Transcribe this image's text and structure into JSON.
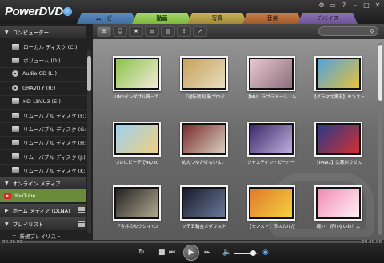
{
  "app": {
    "name": "PowerDVD"
  },
  "tabs": [
    {
      "label": "ムービー",
      "key": "movie"
    },
    {
      "label": "動画",
      "key": "video"
    },
    {
      "label": "写真",
      "key": "photo"
    },
    {
      "label": "音楽",
      "key": "music"
    },
    {
      "label": "デバイス",
      "key": "device"
    }
  ],
  "window_controls": [
    "gear-icon",
    "tv-icon",
    "help-icon",
    "minimize-icon",
    "maximize-icon",
    "close-icon"
  ],
  "sidebar": {
    "computer_label": "コンピューター",
    "drives": [
      {
        "label": "ローカル ディスク (C:)",
        "icon": "drive-icon"
      },
      {
        "label": "ボリューム (D:)",
        "icon": "drive-icon"
      },
      {
        "label": "Audio CD (L:)",
        "icon": "disc-icon"
      },
      {
        "label": "GRAVITY (R:)",
        "icon": "disc-icon"
      },
      {
        "label": "HD-LBVU3 (E:)",
        "icon": "drive-icon"
      },
      {
        "label": "リムーバブル ディスク (F:)",
        "icon": "drive-icon"
      },
      {
        "label": "リムーバブル ディスク (G:)",
        "icon": "drive-icon"
      },
      {
        "label": "リムーバブル ディスク (H:)",
        "icon": "drive-icon"
      },
      {
        "label": "リムーバブル ディスク (J:)",
        "icon": "drive-icon"
      },
      {
        "label": "リムーバブル ディスク (K:)",
        "icon": "drive-icon"
      }
    ],
    "online_label": "オンライン メディア",
    "youtube_label": "YouTube",
    "home_media_label": "ホーム メディア (DLNA)",
    "playlist_label": "プレイリスト",
    "new_playlist_label": "新規プレイリスト"
  },
  "toolbar": {
    "buttons": [
      "grid-view-icon",
      "people-icon",
      "star-icon",
      "list-view-icon",
      "slideshow-icon",
      "upload-icon",
      "share-icon"
    ],
    "search_placeholder": ""
  },
  "videos": [
    {
      "caption": "UNEペンダブル買って",
      "colors": [
        "#8bc34a",
        "#f2e9d8"
      ]
    },
    {
      "caption": "『逆転裁判 新プロジ",
      "colors": [
        "#c7a35a",
        "#e8dcc0"
      ]
    },
    {
      "caption": "【MV】ラブラドール・レ",
      "colors": [
        "#e9c7d1",
        "#8a6f7a"
      ]
    },
    {
      "caption": "【グラマス実況】モンスト",
      "colors": [
        "#4fa3e0",
        "#e6c23a"
      ]
    },
    {
      "caption": "ついにビーチで4K/30",
      "colors": [
        "#9dd0f0",
        "#f0d080"
      ]
    },
    {
      "caption": "めんつゆかけないよ。",
      "colors": [
        "#7a2a2a",
        "#d9d0c0"
      ]
    },
    {
      "caption": "ジャスティン・ビーバー",
      "colors": [
        "#3a2a6a",
        "#c0b0e0"
      ]
    },
    {
      "caption": "【PAW2】久慈川りせ(C",
      "colors": [
        "#2a3a8a",
        "#d23030"
      ]
    },
    {
      "caption": "「今井のセクシィ!CI",
      "colors": [
        "#222222",
        "#b0a890"
      ]
    },
    {
      "caption": "ソチ五輪金メダリスト",
      "colors": [
        "#1a1a2a",
        "#6a7a9a"
      ]
    },
    {
      "caption": "【モンスト】ラスカルだ",
      "colors": [
        "#e07a2a",
        "#f5d040"
      ]
    },
    {
      "caption": "縄い！好れないね！よ",
      "colors": [
        "#f08ab0",
        "#fff0f5"
      ]
    }
  ],
  "player": {
    "time_start": "00:00:00",
    "time_end": "00:00:00",
    "volume_fraction": 0.75
  }
}
